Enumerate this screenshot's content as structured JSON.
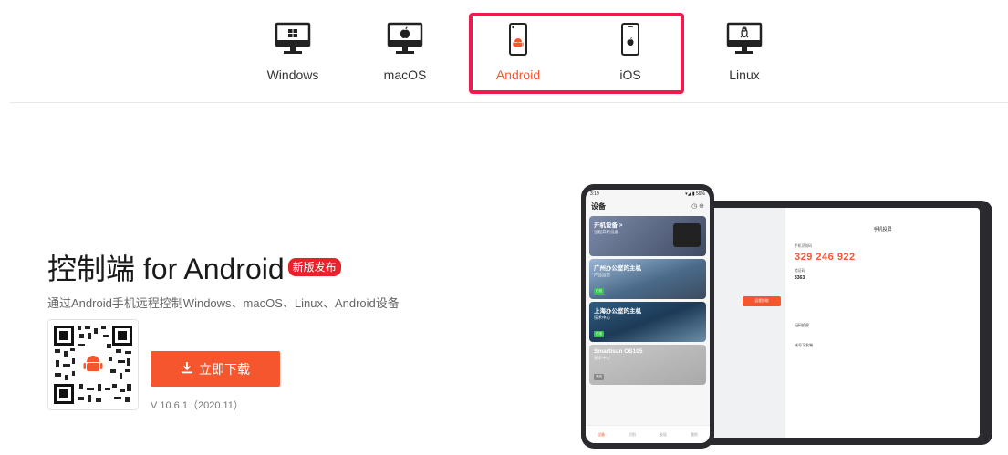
{
  "colors": {
    "accent": "#f5562e",
    "highlight_border": "#ee1b4f",
    "badge": "#e8222b"
  },
  "platform_tabs": [
    {
      "label": "Windows",
      "icon": "monitor-windows-icon",
      "active": false
    },
    {
      "label": "macOS",
      "icon": "monitor-apple-icon",
      "active": false
    },
    {
      "label": "Android",
      "icon": "phone-android-icon",
      "active": true
    },
    {
      "label": "iOS",
      "icon": "phone-apple-icon",
      "active": false
    },
    {
      "label": "Linux",
      "icon": "monitor-linux-icon",
      "active": false
    }
  ],
  "hero": {
    "title": "控制端 for Android",
    "badge": "新版发布",
    "subtitle": "通过Android手机远程控制Windows、macOS、Linux、Android设备"
  },
  "download": {
    "button_label": "立即下载",
    "version": "V 10.6.1（2020.11）"
  },
  "phone": {
    "status_time": "3:19",
    "status_right": "▾◢ ▮ 59%",
    "header_title": "设备",
    "cards": [
      {
        "title": "开机设备 >",
        "sub": "远程开机设备",
        "tag": ""
      },
      {
        "title": "广州办公室的主机",
        "sub": "产品运营",
        "tag": "在线"
      },
      {
        "title": "上海办公室的主机",
        "sub": "技术中心",
        "tag": "在线"
      },
      {
        "title": "Smartisan OS105",
        "sub": "技术中心",
        "tag": "离线"
      }
    ],
    "nav": [
      "设备",
      "识别",
      "发现",
      "我的"
    ]
  },
  "tablet": {
    "title": "手机投屏",
    "code_label": "手机识别码",
    "code": "329 246 922",
    "verify_label": "验证码",
    "verify": "3363",
    "rows": [
      "扫码投屏",
      "帐号下发端"
    ],
    "connect_button": "远程协助"
  }
}
